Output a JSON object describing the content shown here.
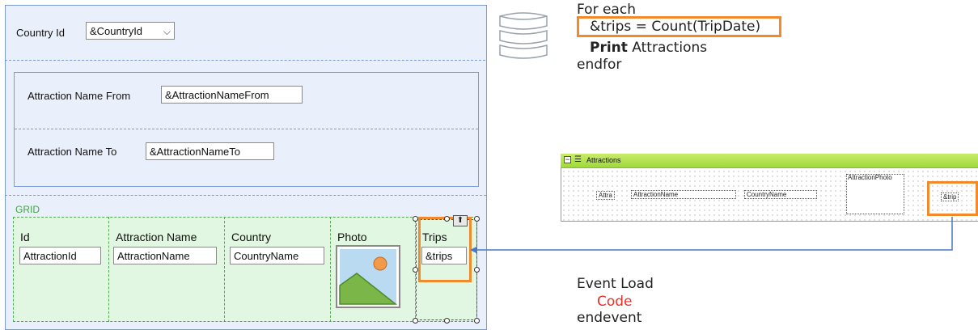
{
  "form": {
    "country": {
      "label": "Country Id",
      "value": "&CountryId"
    },
    "attraction_from": {
      "label": "Attraction Name From",
      "value": "&AttractionNameFrom"
    },
    "attraction_to": {
      "label": "Attraction Name To",
      "value": "&AttractionNameTo"
    },
    "grid": {
      "title": "GRID",
      "columns": [
        {
          "header": "Id",
          "value": "AttractionId"
        },
        {
          "header": "Attraction Name",
          "value": "AttractionName"
        },
        {
          "header": "Country",
          "value": "CountryName"
        },
        {
          "header": "Photo",
          "value": ""
        },
        {
          "header": "Trips",
          "value": "&trips"
        }
      ]
    }
  },
  "code_top": {
    "line1": "For each",
    "line2": "&trips = Count(TripDate)",
    "line3_kw": "Print",
    "line3_rest": " Attractions",
    "line4": "endfor"
  },
  "code_bottom": {
    "line1": "Event Load",
    "line2": "Code",
    "line3": "endevent"
  },
  "report": {
    "title": "Attractions",
    "fields": {
      "attra": "Attra",
      "name": "AttractionName",
      "country": "CountryName",
      "photo": "AttractionPhoto",
      "trips": "&trip"
    }
  },
  "colors": {
    "highlight": "#f08a2c",
    "code_red": "#e8322a",
    "grid_green": "#3fa83f",
    "panel_blue": "#7a9bd4"
  }
}
